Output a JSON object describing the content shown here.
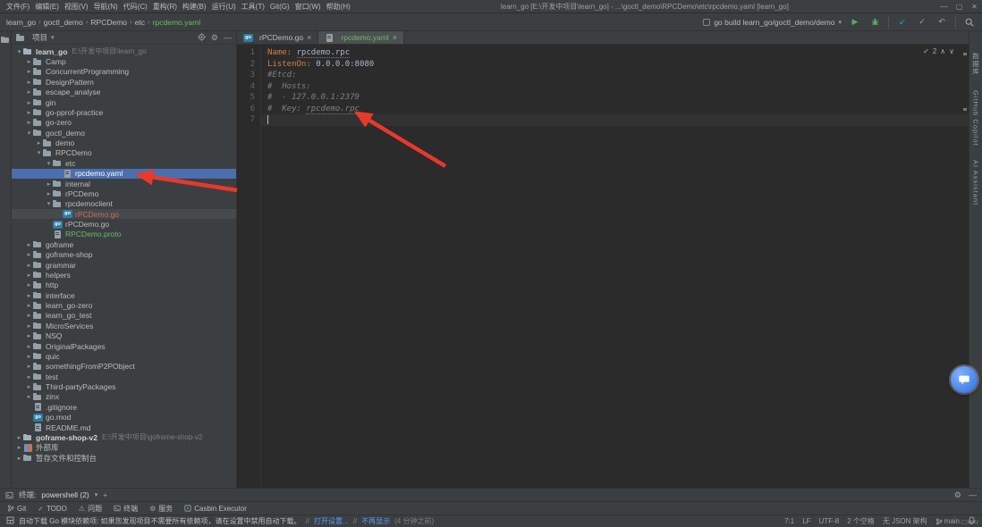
{
  "colors": {
    "selection": "#4B6EAF",
    "git_added": "#6FB76A",
    "git_untracked": "#D1675A",
    "arrow_red": "#E8392B",
    "link_blue": "#589DF6"
  },
  "window": {
    "title": "learn_go [E:\\开发中项目\\learn_go] - ...\\goctl_demo\\RPCDemo\\etc\\rpcdemo.yaml [learn_go]",
    "menu": [
      "文件(F)",
      "编辑(E)",
      "视图(V)",
      "导航(N)",
      "代码(C)",
      "重构(R)",
      "构建(B)",
      "运行(U)",
      "工具(T)",
      "Git(G)",
      "窗口(W)",
      "帮助(H)"
    ],
    "controls": {
      "minimize": "—",
      "maximize": "▢",
      "close": "✕"
    }
  },
  "navbar": {
    "breadcrumbs": [
      {
        "label": "learn_go"
      },
      {
        "label": "goctl_demo"
      },
      {
        "label": "RPCDemo"
      },
      {
        "label": "etc"
      },
      {
        "label": "rpcdemo.yaml",
        "status": "added"
      }
    ],
    "run_config": "go build learn_go/goctl_demo/demo"
  },
  "project_panel": {
    "title": "项目",
    "tree": [
      {
        "label": "learn_go",
        "suffix": "E:\\开发中项目\\learn_go",
        "depth": 0,
        "kind": "project",
        "state": "open",
        "bold": true
      },
      {
        "label": "Camp",
        "depth": 1,
        "kind": "folder",
        "state": "closed"
      },
      {
        "label": "ConcurrentProgramming",
        "depth": 1,
        "kind": "folder",
        "state": "closed"
      },
      {
        "label": "DesignPattern",
        "depth": 1,
        "kind": "folder",
        "state": "closed"
      },
      {
        "label": "escape_analyse",
        "depth": 1,
        "kind": "folder",
        "state": "closed"
      },
      {
        "label": "gin",
        "depth": 1,
        "kind": "folder",
        "state": "closed"
      },
      {
        "label": "go-pprof-practice",
        "depth": 1,
        "kind": "folder",
        "state": "closed"
      },
      {
        "label": "go-zero",
        "depth": 1,
        "kind": "folder",
        "state": "closed"
      },
      {
        "label": "goctl_demo",
        "depth": 1,
        "kind": "folder",
        "state": "open"
      },
      {
        "label": "demo",
        "depth": 2,
        "kind": "folder",
        "state": "closed"
      },
      {
        "label": "RPCDemo",
        "depth": 2,
        "kind": "folder",
        "state": "open"
      },
      {
        "label": "etc",
        "depth": 3,
        "kind": "folder",
        "state": "open"
      },
      {
        "label": "rpcdemo.yaml",
        "depth": 4,
        "kind": "yaml",
        "selected": true
      },
      {
        "label": "internal",
        "depth": 3,
        "kind": "folder",
        "state": "closed"
      },
      {
        "label": "rPCDemo",
        "depth": 3,
        "kind": "folder",
        "state": "closed"
      },
      {
        "label": "rpcdemoclient",
        "depth": 3,
        "kind": "folder",
        "state": "open"
      },
      {
        "label": "rPCDemo.go",
        "depth": 4,
        "kind": "go",
        "status": "untracked",
        "rowbg": true
      },
      {
        "label": "rPCDemo.go",
        "depth": 3,
        "kind": "go"
      },
      {
        "label": "RPCDemo.proto",
        "depth": 3,
        "kind": "proto",
        "status": "added"
      },
      {
        "label": "goframe",
        "depth": 1,
        "kind": "folder",
        "state": "closed"
      },
      {
        "label": "goframe-shop",
        "depth": 1,
        "kind": "folder",
        "state": "closed"
      },
      {
        "label": "grammar",
        "depth": 1,
        "kind": "folder",
        "state": "closed"
      },
      {
        "label": "helpers",
        "depth": 1,
        "kind": "folder",
        "state": "closed"
      },
      {
        "label": "http",
        "depth": 1,
        "kind": "folder",
        "state": "closed"
      },
      {
        "label": "interface",
        "depth": 1,
        "kind": "folder",
        "state": "closed"
      },
      {
        "label": "learn_go-zero",
        "depth": 1,
        "kind": "folder",
        "state": "closed"
      },
      {
        "label": "learn_go_test",
        "depth": 1,
        "kind": "folder",
        "state": "closed"
      },
      {
        "label": "MicroServices",
        "depth": 1,
        "kind": "folder",
        "state": "closed"
      },
      {
        "label": "NSQ",
        "depth": 1,
        "kind": "folder",
        "state": "closed"
      },
      {
        "label": "OriginalPackages",
        "depth": 1,
        "kind": "folder",
        "state": "closed"
      },
      {
        "label": "quic",
        "depth": 1,
        "kind": "folder",
        "state": "closed"
      },
      {
        "label": "somethingFromP2PObject",
        "depth": 1,
        "kind": "folder",
        "state": "closed"
      },
      {
        "label": "test",
        "depth": 1,
        "kind": "folder",
        "state": "closed"
      },
      {
        "label": "Third-partyPackages",
        "depth": 1,
        "kind": "folder",
        "state": "closed"
      },
      {
        "label": "zinx",
        "depth": 1,
        "kind": "folder",
        "state": "closed"
      },
      {
        "label": ".gitignore",
        "depth": 1,
        "kind": "file"
      },
      {
        "label": "go.mod",
        "depth": 1,
        "kind": "gomod"
      },
      {
        "label": "README.md",
        "depth": 1,
        "kind": "file"
      },
      {
        "label": "goframe-shop-v2",
        "suffix": "E:\\开发中项目\\goframe-shop-v2",
        "depth": 0,
        "kind": "project",
        "state": "closed",
        "bold": true
      },
      {
        "label": "外部库",
        "depth": 0,
        "kind": "lib",
        "state": "closed"
      },
      {
        "label": "暂存文件和控制台",
        "depth": 0,
        "kind": "scratch",
        "state": "closed"
      }
    ]
  },
  "tabs": [
    {
      "label": "rPCDemo.go",
      "icon": "go",
      "active": false
    },
    {
      "label": "rpcdemo.yaml",
      "icon": "yaml",
      "active": true,
      "status": "added"
    }
  ],
  "editor": {
    "inspections": {
      "ok": "✔",
      "count": "2",
      "up": "∧",
      "down": "∨"
    },
    "lines": [
      {
        "num": 1,
        "tokens": [
          {
            "t": "Name:",
            "c": "key"
          },
          {
            "t": " ",
            "c": "plain"
          },
          {
            "t": "rpcdemo.rpc",
            "c": "value",
            "u": true
          }
        ]
      },
      {
        "num": 2,
        "tokens": [
          {
            "t": "ListenOn:",
            "c": "key"
          },
          {
            "t": " 0.0.0.0:8080",
            "c": "value"
          }
        ]
      },
      {
        "num": 3,
        "tokens": [
          {
            "t": "#Etcd:",
            "c": "comment"
          }
        ]
      },
      {
        "num": 4,
        "tokens": [
          {
            "t": "#  Hosts:",
            "c": "comment"
          }
        ]
      },
      {
        "num": 5,
        "tokens": [
          {
            "t": "#  - 127.0.0.1:2379",
            "c": "comment"
          }
        ]
      },
      {
        "num": 6,
        "tokens": [
          {
            "t": "#  Key: ",
            "c": "comment"
          },
          {
            "t": "rpcdemo.rpc",
            "c": "comment",
            "u": true
          }
        ]
      },
      {
        "num": 7,
        "tokens": [],
        "caret": true
      }
    ]
  },
  "terminal": {
    "title": "终端:",
    "session": "powershell (2)"
  },
  "toolwindow_bar": [
    {
      "label": "Git",
      "icon": "branch"
    },
    {
      "label": "TODO",
      "icon": "check"
    },
    {
      "label": "问题",
      "icon": "warning"
    },
    {
      "label": "终端",
      "icon": "terminal"
    },
    {
      "label": "服务",
      "icon": "services"
    },
    {
      "label": "Casbin Executor",
      "icon": "executor"
    }
  ],
  "statusbar": {
    "message": "自动下载 Go 模块依赖项: 如果您发现项目不需要所有依赖项，请在设置中禁用自动下载。",
    "separator": "//",
    "link_settings": "打开设置...",
    "link_dismiss": "不再显示",
    "time": "(4 分钟之前)",
    "caret": "7:1",
    "line_ending": "LF",
    "encoding": "UTF-8",
    "indent": "2 个空格",
    "schema": "无 JSON 架构",
    "branch": "main"
  },
  "right_stripe": [
    "数据库",
    "GitHub Copilot",
    "AI Assistant"
  ],
  "watermark": "CSDN"
}
